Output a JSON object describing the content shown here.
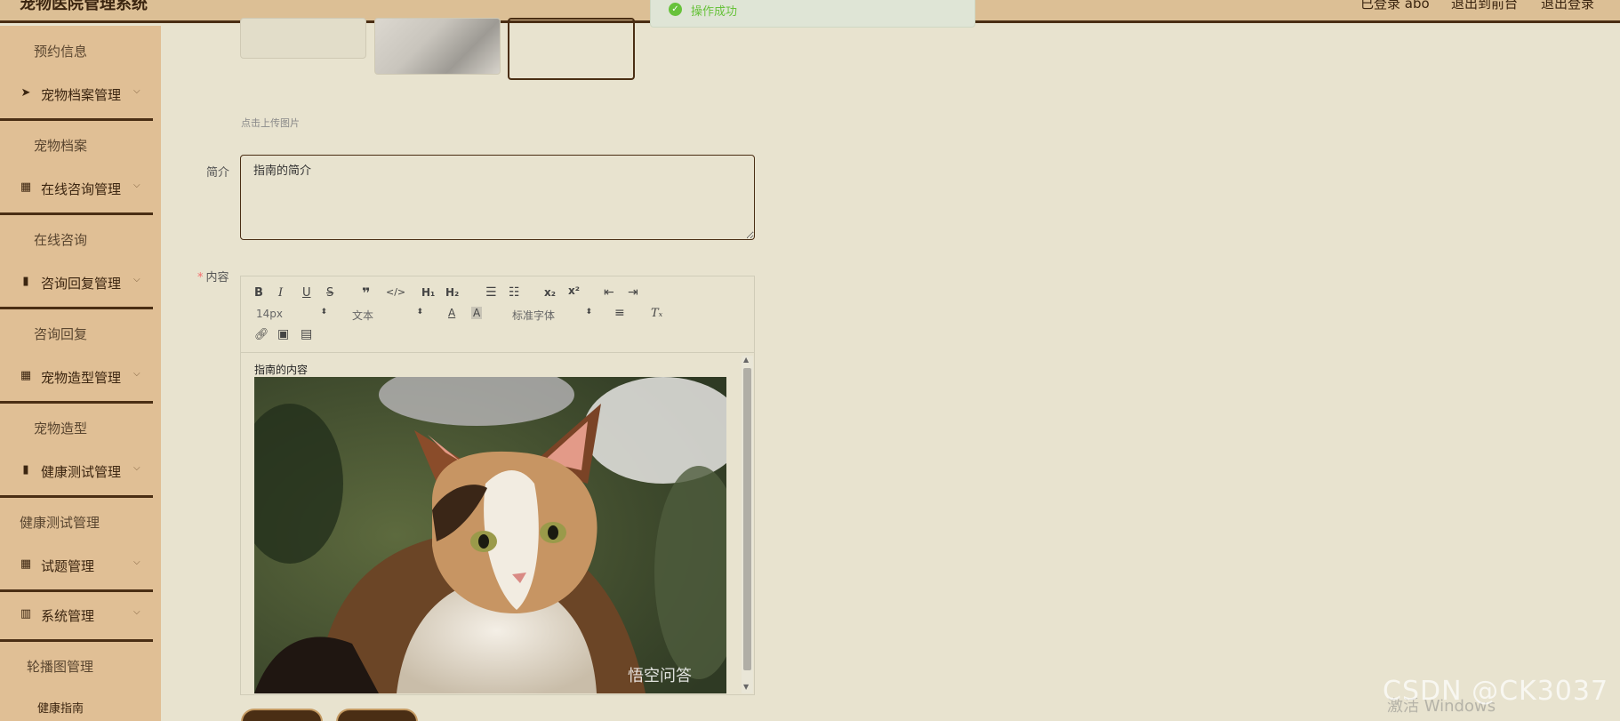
{
  "header": {
    "app_title": "宠物医院管理系统",
    "user_link": "已登录 abo",
    "front_link": "退出到前台",
    "logout_link": "退出登录"
  },
  "toast": {
    "message": "操作成功"
  },
  "sidebar": {
    "items": [
      {
        "type": "sub",
        "label": "预约信息"
      },
      {
        "type": "menu",
        "label": "宠物档案管理",
        "icon": "send-icon"
      },
      {
        "type": "sub",
        "label": "宠物档案"
      },
      {
        "type": "menu",
        "label": "在线咨询管理",
        "icon": "grid-icon"
      },
      {
        "type": "sub",
        "label": "在线咨询"
      },
      {
        "type": "menu",
        "label": "咨询回复管理",
        "icon": "clipboard-icon"
      },
      {
        "type": "sub",
        "label": "咨询回复"
      },
      {
        "type": "menu",
        "label": "宠物造型管理",
        "icon": "grid-icon"
      },
      {
        "type": "sub",
        "label": "宠物造型"
      },
      {
        "type": "menu",
        "label": "健康测试管理",
        "icon": "clipboard-icon"
      },
      {
        "type": "sub",
        "label": "健康测试管理"
      },
      {
        "type": "menu",
        "label": "试题管理",
        "icon": "grid-icon"
      },
      {
        "type": "menu",
        "label": "系统管理",
        "icon": "bars-icon"
      },
      {
        "type": "sub",
        "label": "轮播图管理"
      },
      {
        "type": "sub",
        "label": "健康指南"
      }
    ]
  },
  "form": {
    "upload_hint": "点击上传图片",
    "intro_label": "简介",
    "intro_value": "指南的简介",
    "content_label": "内容",
    "content_required_mark": "*"
  },
  "editor": {
    "font_size": "14px",
    "heading": "文本",
    "font_family": "标准字体",
    "content_text": "指南的内容",
    "image_watermark": "悟空问答"
  },
  "watermarks": {
    "csdn": "CSDN @CK3037",
    "windows": "激活 Windows"
  },
  "colors": {
    "page_bg": "#e8e3cf",
    "sidebar_bg": "#e0bf95",
    "accent_dark": "#4a2e14",
    "success": "#67c23a"
  }
}
